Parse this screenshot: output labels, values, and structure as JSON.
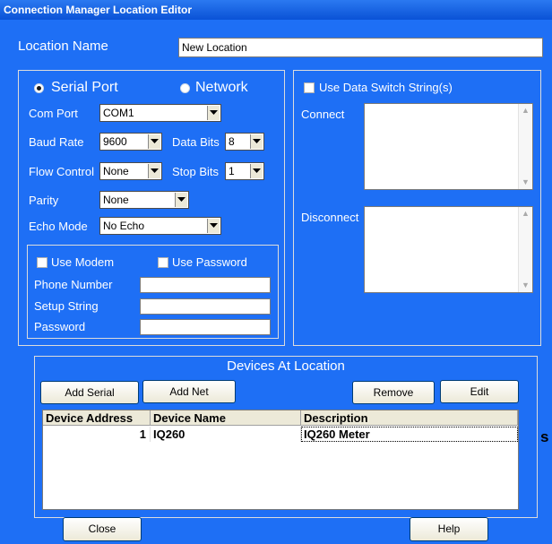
{
  "window": {
    "title": "Connection Manager Location Editor"
  },
  "location": {
    "label": "Location Name",
    "value": "New Location"
  },
  "connection": {
    "serial_label": "Serial Port",
    "network_label": "Network",
    "com_port": {
      "label": "Com Port",
      "value": "COM1"
    },
    "baud_rate": {
      "label": "Baud Rate",
      "value": "9600"
    },
    "data_bits": {
      "label": "Data Bits",
      "value": "8"
    },
    "flow_control": {
      "label": "Flow Control",
      "value": "None"
    },
    "stop_bits": {
      "label": "Stop Bits",
      "value": "1"
    },
    "parity": {
      "label": "Parity",
      "value": "None"
    },
    "echo_mode": {
      "label": "Echo Mode",
      "value": "No Echo"
    }
  },
  "modem": {
    "use_modem_label": "Use Modem",
    "use_password_label": "Use Password",
    "phone_label": "Phone Number",
    "setup_label": "Setup String",
    "password_label": "Password"
  },
  "switch": {
    "use_label": "Use Data Switch String(s)",
    "connect_label": "Connect",
    "disconnect_label": "Disconnect"
  },
  "devices": {
    "title": "Devices At Location",
    "add_serial": "Add Serial",
    "add_net": "Add Net",
    "remove": "Remove",
    "edit": "Edit",
    "columns": [
      "Device Address",
      "Device Name",
      "Description"
    ],
    "rows": [
      {
        "address": "1",
        "name": "IQ260",
        "description": "IQ260 Meter"
      }
    ]
  },
  "footer": {
    "close": "Close",
    "help": "Help"
  },
  "outside_text": "s",
  "colors": {
    "background": "#1e6ff5",
    "titlebar": "#0a52d6"
  }
}
